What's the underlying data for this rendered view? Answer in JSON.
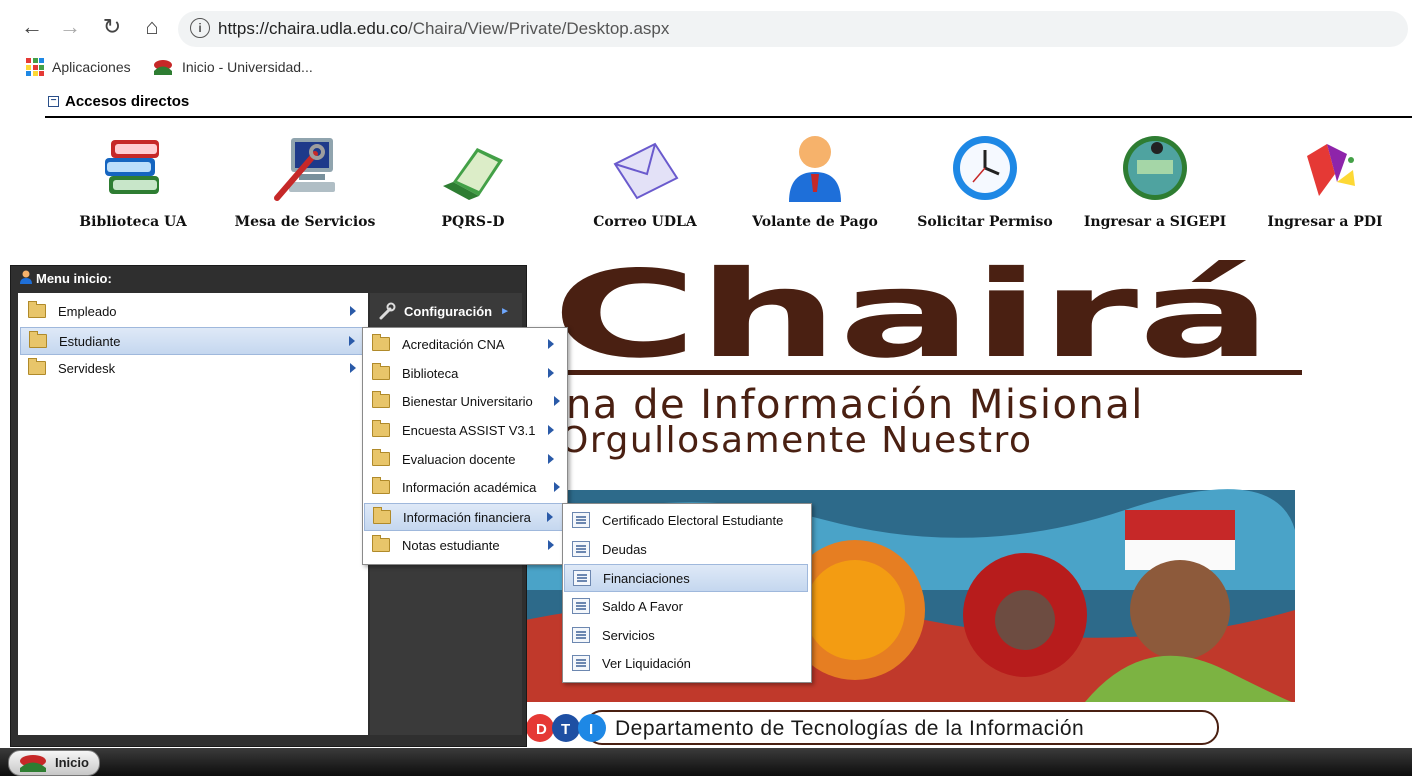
{
  "browser": {
    "url_host": "https://chaira.udla.edu.co",
    "url_path": "/Chaira/View/Private/Desktop.aspx",
    "bookmarks": [
      {
        "label": "Aplicaciones",
        "icon": "apps-grid-icon"
      },
      {
        "label": "Inicio - Universidad...",
        "icon": "udla-logo-icon"
      }
    ]
  },
  "accesos": {
    "title": "Accesos directos",
    "items": [
      {
        "label": "Biblioteca UA",
        "icon": "books-icon"
      },
      {
        "label": "Mesa de Servicios",
        "icon": "computer-wrench-icon"
      },
      {
        "label": "PQRS-D",
        "icon": "laptop-icon"
      },
      {
        "label": "Correo UDLA",
        "icon": "envelope-icon"
      },
      {
        "label": "Volante de Pago",
        "icon": "person-icon"
      },
      {
        "label": "Solicitar Permiso",
        "icon": "clock-icon"
      },
      {
        "label": "Ingresar a SIGEPI",
        "icon": "sigepi-logo-icon"
      },
      {
        "label": "Ingresar a PDI",
        "icon": "pdi-logo-icon"
      }
    ]
  },
  "banner": {
    "logo_text": "Chairá",
    "subtitle1": "na de Información Misional",
    "subtitle2": "Orgullosamente Nuestro",
    "dti_letters": [
      "D",
      "T",
      "I"
    ],
    "dti_text": "Departamento de Tecnologías de la Información"
  },
  "menu": {
    "title": "Menu inicio:",
    "config_label": "Configuración",
    "level1": [
      "Empleado",
      "Estudiante",
      "Servidesk"
    ],
    "level1_selected": "Estudiante",
    "level2": [
      "Acreditación CNA",
      "Biblioteca",
      "Bienestar Universitario",
      "Encuesta ASSIST V3.1",
      "Evaluacion docente",
      "Información académica",
      "Información financiera",
      "Notas estudiante"
    ],
    "level2_selected": "Información financiera",
    "level3": [
      "Certificado Electoral Estudiante",
      "Deudas",
      "Financiaciones",
      "Saldo A Favor",
      "Servicios",
      "Ver Liquidación"
    ],
    "level3_hover": "Financiaciones"
  },
  "taskbar": {
    "start_label": "Inicio"
  },
  "colors": {
    "brand_brown": "#4a2012",
    "menu_dark": "#2f2f2f",
    "selection_blue": "#c5d7ef"
  }
}
